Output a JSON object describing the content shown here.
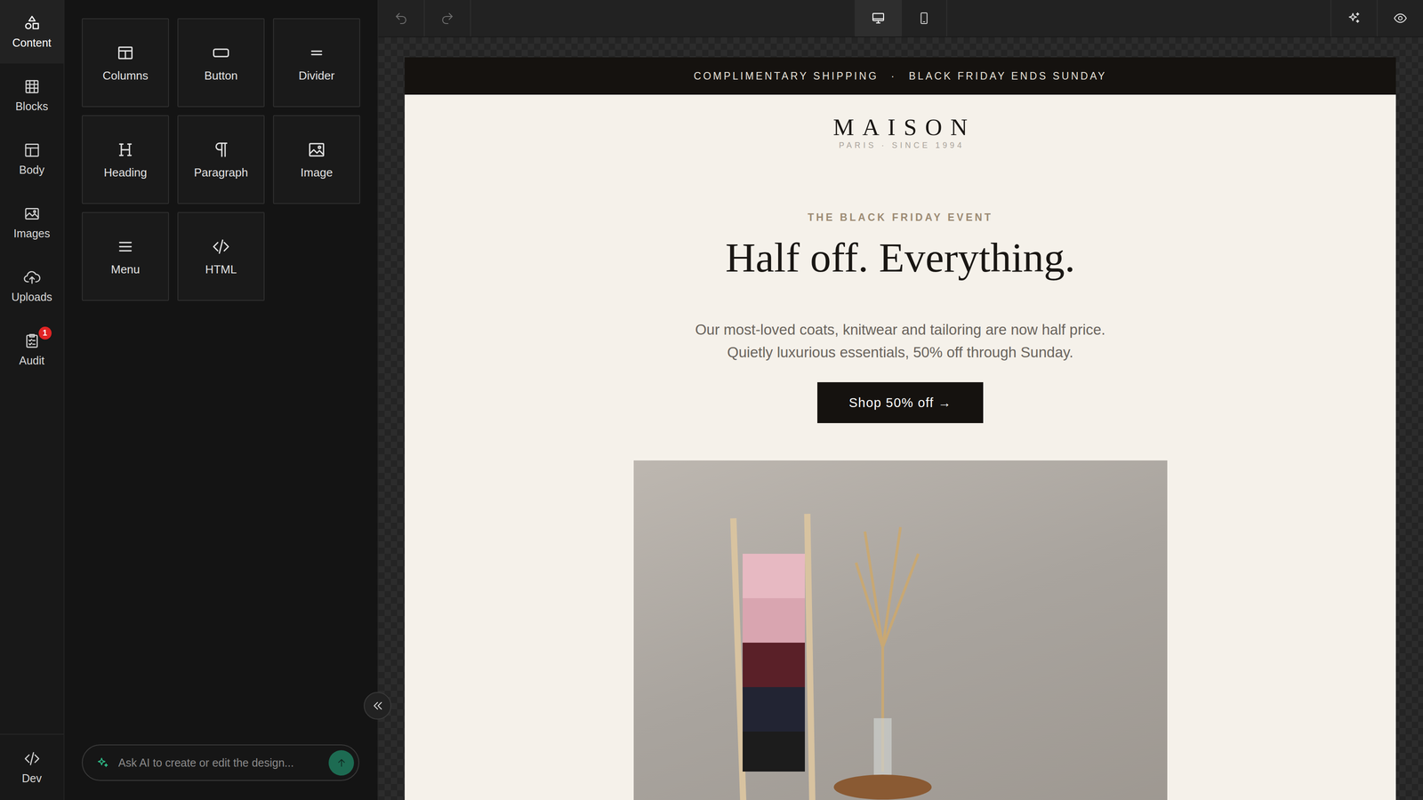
{
  "rail": {
    "items": [
      {
        "label": "Content",
        "selected": true
      },
      {
        "label": "Blocks",
        "selected": false
      },
      {
        "label": "Body",
        "selected": false
      },
      {
        "label": "Images",
        "selected": false
      },
      {
        "label": "Uploads",
        "selected": false
      },
      {
        "label": "Audit",
        "selected": false,
        "badge": "1"
      }
    ],
    "footer": {
      "label": "Dev"
    }
  },
  "tiles": [
    {
      "label": "Columns"
    },
    {
      "label": "Button"
    },
    {
      "label": "Divider"
    },
    {
      "label": "Heading"
    },
    {
      "label": "Paragraph"
    },
    {
      "label": "Image"
    },
    {
      "label": "Menu"
    },
    {
      "label": "HTML"
    }
  ],
  "ai": {
    "placeholder": "Ask AI to create or edit the design..."
  },
  "toolbar": {
    "views": [
      {
        "kind": "desktop",
        "selected": true
      },
      {
        "kind": "mobile",
        "selected": false
      }
    ]
  },
  "email": {
    "announcement": [
      "COMPLIMENTARY SHIPPING",
      "·",
      "BLACK FRIDAY ENDS SUNDAY"
    ],
    "logo": "MAISON",
    "logo_sub": "PARIS · SINCE 1994",
    "eyebrow": "THE BLACK FRIDAY EVENT",
    "headline": "Half off. Everything.",
    "lead": "Our most-loved coats, knitwear and tailoring are now half price. Quietly luxurious essentials, 50% off through Sunday.",
    "cta": "Shop 50% off →"
  }
}
